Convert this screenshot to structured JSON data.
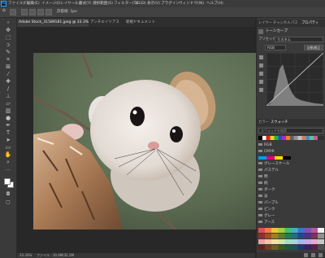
{
  "menu": {
    "app_icon": "Ps",
    "items": [
      "ファイル(F)",
      "編集(E)",
      "イメージ(I)",
      "レイヤー(L)",
      "書式(Y)",
      "選択範囲(S)",
      "フィルター(T)",
      "3D(D)",
      "表示(V)",
      "プラグイン",
      "ウィンドウ(W)",
      "ヘルプ(H)"
    ]
  },
  "options": {
    "tolerance": "許容値: 1px"
  },
  "document_tabs": [
    {
      "label": "Adobe Stock_31589181.jpeg @ 33.3% (トーンカーブ 1, レイヤーマスク/8)",
      "active": true
    },
    {
      "label": "アンチエイリアス",
      "active": false
    },
    {
      "label": "新規ドキュメント",
      "active": false
    }
  ],
  "status_bar": {
    "zoom": "33.33%",
    "info": "ファイル : 10.4M/32.2M"
  },
  "properties_panel": {
    "tabs": [
      "レイヤー",
      "チャンネル",
      "パス",
      "プロパティ"
    ],
    "title": "トーンカーブ",
    "preset_label": "プリセット",
    "preset_value": "カスタム",
    "channel_value": "RGB",
    "auto_button": "自動補正"
  },
  "swatches_panel": {
    "tabs": [
      "カラー",
      "スウォッチ"
    ],
    "search_placeholder": "スウォッチを検索",
    "groups": [
      "RGB",
      "CMYK",
      "グレースケール",
      "パステル",
      "明",
      "純",
      "ダーク",
      "淡",
      "パープル",
      "ピンク",
      "グレー",
      "アース"
    ]
  },
  "colors": {
    "brand": "#31a8ff",
    "menubar": "#3b3b3b",
    "panel": "#3a3a3a",
    "canvas": "#282828"
  }
}
